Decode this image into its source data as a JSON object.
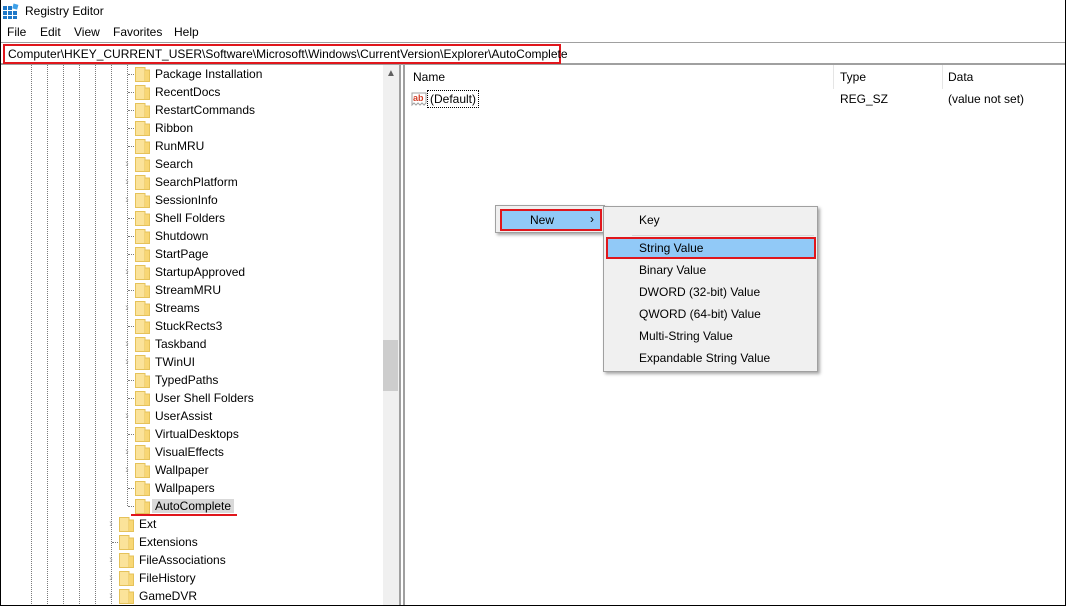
{
  "window": {
    "title": "Registry Editor",
    "icon": "registry-editor-icon"
  },
  "menubar": {
    "items": [
      {
        "label": "File"
      },
      {
        "label": "Edit"
      },
      {
        "label": "View"
      },
      {
        "label": "Favorites"
      },
      {
        "label": "Help"
      }
    ]
  },
  "address": {
    "path": "Computer\\HKEY_CURRENT_USER\\Software\\Microsoft\\Windows\\CurrentVersion\\Explorer\\AutoComplete",
    "highlight_color": "#e0161c"
  },
  "tree": {
    "items": [
      {
        "label": "Package Installation",
        "expandable": false,
        "depth": 8
      },
      {
        "label": "RecentDocs",
        "expandable": false,
        "depth": 8
      },
      {
        "label": "RestartCommands",
        "expandable": false,
        "depth": 8
      },
      {
        "label": "Ribbon",
        "expandable": false,
        "depth": 8
      },
      {
        "label": "RunMRU",
        "expandable": false,
        "depth": 8
      },
      {
        "label": "Search",
        "expandable": true,
        "depth": 8
      },
      {
        "label": "SearchPlatform",
        "expandable": true,
        "depth": 8
      },
      {
        "label": "SessionInfo",
        "expandable": true,
        "depth": 8
      },
      {
        "label": "Shell Folders",
        "expandable": false,
        "depth": 8
      },
      {
        "label": "Shutdown",
        "expandable": false,
        "depth": 8
      },
      {
        "label": "StartPage",
        "expandable": false,
        "depth": 8
      },
      {
        "label": "StartupApproved",
        "expandable": true,
        "depth": 8
      },
      {
        "label": "StreamMRU",
        "expandable": false,
        "depth": 8
      },
      {
        "label": "Streams",
        "expandable": true,
        "depth": 8
      },
      {
        "label": "StuckRects3",
        "expandable": false,
        "depth": 8
      },
      {
        "label": "Taskband",
        "expandable": true,
        "depth": 8
      },
      {
        "label": "TWinUI",
        "expandable": true,
        "depth": 8
      },
      {
        "label": "TypedPaths",
        "expandable": false,
        "depth": 8
      },
      {
        "label": "User Shell Folders",
        "expandable": false,
        "depth": 8
      },
      {
        "label": "UserAssist",
        "expandable": true,
        "depth": 8
      },
      {
        "label": "VirtualDesktops",
        "expandable": false,
        "depth": 8
      },
      {
        "label": "VisualEffects",
        "expandable": true,
        "depth": 8
      },
      {
        "label": "Wallpaper",
        "expandable": true,
        "depth": 8
      },
      {
        "label": "Wallpapers",
        "expandable": false,
        "depth": 8
      },
      {
        "label": "AutoComplete",
        "expandable": false,
        "depth": 8,
        "selected": true
      },
      {
        "label": "Ext",
        "expandable": true,
        "depth": 7
      },
      {
        "label": "Extensions",
        "expandable": false,
        "depth": 7
      },
      {
        "label": "FileAssociations",
        "expandable": true,
        "depth": 7
      },
      {
        "label": "FileHistory",
        "expandable": true,
        "depth": 7
      },
      {
        "label": "GameDVR",
        "expandable": true,
        "depth": 7
      }
    ]
  },
  "list": {
    "columns": [
      {
        "label": "Name"
      },
      {
        "label": "Type"
      },
      {
        "label": "Data"
      }
    ],
    "rows": [
      {
        "name": "(Default)",
        "type": "REG_SZ",
        "data": "(value not set)",
        "icon": "string-value-icon"
      }
    ]
  },
  "context_menu": {
    "new_label": "New",
    "new_arrow": "›",
    "submenu": [
      {
        "label": "Key"
      },
      {
        "label": "String Value",
        "highlighted": true
      },
      {
        "label": "Binary Value"
      },
      {
        "label": "DWORD (32-bit) Value"
      },
      {
        "label": "QWORD (64-bit) Value"
      },
      {
        "label": "Multi-String Value"
      },
      {
        "label": "Expandable String Value"
      }
    ]
  }
}
